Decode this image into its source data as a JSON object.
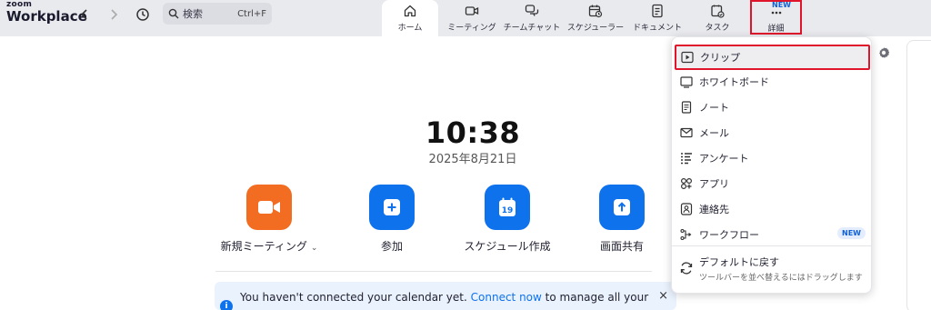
{
  "brand": {
    "line1": "zoom",
    "line2": "Workplace"
  },
  "search": {
    "placeholder": "検索",
    "shortcut": "Ctrl+F"
  },
  "tabs": [
    {
      "label": "ホーム",
      "icon": "home-icon"
    },
    {
      "label": "ミーティング",
      "icon": "video-icon"
    },
    {
      "label": "チームチャット",
      "icon": "chat-icon"
    },
    {
      "label": "スケジューラー",
      "icon": "calendar-clock-icon"
    },
    {
      "label": "ドキュメント",
      "icon": "document-icon"
    },
    {
      "label": "タスク",
      "icon": "task-icon"
    },
    {
      "label": "詳細",
      "icon": "more-icon",
      "badge": "NEW"
    }
  ],
  "clock": {
    "time": "10:38",
    "date": "2025年8月21日"
  },
  "actions": [
    {
      "label": "新規ミーティング",
      "icon": "video-camera-icon",
      "color": "#f26d21"
    },
    {
      "label": "参加",
      "icon": "plus-icon",
      "color": "#0e72ed"
    },
    {
      "label": "スケジュール作成",
      "icon": "calendar-icon",
      "color": "#0e72ed",
      "calendar_day": "19"
    },
    {
      "label": "画面共有",
      "icon": "share-arrow-icon",
      "color": "#0e72ed"
    }
  ],
  "banner": {
    "text_before": "You haven't connected your calendar yet.",
    "link": "Connect now",
    "text_after": "to manage all your",
    "close": "×",
    "info_glyph": "i"
  },
  "menu": {
    "items": [
      {
        "label": "クリップ",
        "icon": "clips-icon"
      },
      {
        "label": "ホワイトボード",
        "icon": "whiteboard-icon"
      },
      {
        "label": "ノート",
        "icon": "notes-icon"
      },
      {
        "label": "メール",
        "icon": "mail-icon"
      },
      {
        "label": "アンケート",
        "icon": "survey-icon"
      },
      {
        "label": "アプリ",
        "icon": "apps-icon"
      },
      {
        "label": "連絡先",
        "icon": "contacts-icon"
      },
      {
        "label": "ワークフロー",
        "icon": "workflow-icon",
        "badge": "NEW"
      }
    ],
    "reset": {
      "title": "デフォルトに戻す",
      "subtitle": "ツールバーを並べ替えるにはドラッグします"
    }
  },
  "colors": {
    "accent": "#0e72ed",
    "highlight_border": "#e0142b",
    "topbar": "#e9eaee"
  }
}
